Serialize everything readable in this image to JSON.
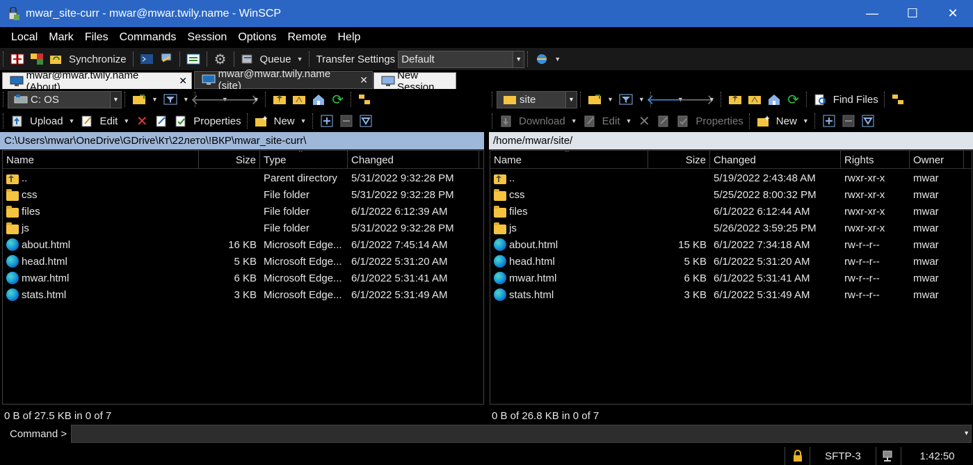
{
  "window": {
    "title": "mwar_site-curr - mwar@mwar.twily.name - WinSCP",
    "minimize": "—",
    "maximize": "☐",
    "close": "✕"
  },
  "menu": [
    "Local",
    "Mark",
    "Files",
    "Commands",
    "Session",
    "Options",
    "Remote",
    "Help"
  ],
  "toolbar": {
    "synchronize": "Synchronize",
    "queue": "Queue",
    "transfer_settings_label": "Transfer Settings",
    "transfer_settings_value": "Default"
  },
  "tabs": [
    {
      "label": "mwar@mwar.twily.name (About)",
      "close": "✕"
    },
    {
      "label": "mwar@mwar.twily.name (site)",
      "close": "✕"
    },
    {
      "label": "New Session"
    }
  ],
  "left": {
    "drive": "C: OS",
    "upload": "Upload",
    "edit": "Edit",
    "properties": "Properties",
    "new": "New",
    "path": "C:\\Users\\mwar\\OneDrive\\GDrive\\Кт\\22лето\\!ВКР\\mwar_site-curr\\",
    "columns": {
      "name": "Name",
      "size": "Size",
      "type": "Type",
      "changed": "Changed"
    },
    "files": [
      {
        "icon": "updir",
        "name": "..",
        "size": "",
        "type": "Parent directory",
        "changed": "5/31/2022  9:32:28 PM"
      },
      {
        "icon": "folder",
        "name": "css",
        "size": "",
        "type": "File folder",
        "changed": "5/31/2022  9:32:28 PM"
      },
      {
        "icon": "folder",
        "name": "files",
        "size": "",
        "type": "File folder",
        "changed": "6/1/2022  6:12:39 AM"
      },
      {
        "icon": "folder",
        "name": "js",
        "size": "",
        "type": "File folder",
        "changed": "5/31/2022  9:32:28 PM"
      },
      {
        "icon": "edge",
        "name": "about.html",
        "size": "16 KB",
        "type": "Microsoft Edge...",
        "changed": "6/1/2022  7:45:14 AM"
      },
      {
        "icon": "edge",
        "name": "head.html",
        "size": "5 KB",
        "type": "Microsoft Edge...",
        "changed": "6/1/2022  5:31:20 AM"
      },
      {
        "icon": "edge",
        "name": "mwar.html",
        "size": "6 KB",
        "type": "Microsoft Edge...",
        "changed": "6/1/2022  5:31:41 AM"
      },
      {
        "icon": "edge",
        "name": "stats.html",
        "size": "3 KB",
        "type": "Microsoft Edge...",
        "changed": "6/1/2022  5:31:49 AM"
      }
    ],
    "status": "0 B of 27.5 KB in 0 of 7"
  },
  "right": {
    "dir": "site",
    "find_files": "Find Files",
    "download": "Download",
    "edit": "Edit",
    "properties": "Properties",
    "new": "New",
    "path": "/home/mwar/site/",
    "columns": {
      "name": "Name",
      "size": "Size",
      "changed": "Changed",
      "rights": "Rights",
      "owner": "Owner"
    },
    "files": [
      {
        "icon": "updir",
        "name": "..",
        "size": "",
        "changed": "5/19/2022 2:43:48 AM",
        "rights": "rwxr-xr-x",
        "owner": "mwar"
      },
      {
        "icon": "folder",
        "name": "css",
        "size": "",
        "changed": "5/25/2022 8:00:32 PM",
        "rights": "rwxr-xr-x",
        "owner": "mwar"
      },
      {
        "icon": "folder",
        "name": "files",
        "size": "",
        "changed": "6/1/2022 6:12:44 AM",
        "rights": "rwxr-xr-x",
        "owner": "mwar"
      },
      {
        "icon": "folder",
        "name": "js",
        "size": "",
        "changed": "5/26/2022 3:59:25 PM",
        "rights": "rwxr-xr-x",
        "owner": "mwar"
      },
      {
        "icon": "edge",
        "name": "about.html",
        "size": "15 KB",
        "changed": "6/1/2022 7:34:18 AM",
        "rights": "rw-r--r--",
        "owner": "mwar"
      },
      {
        "icon": "edge",
        "name": "head.html",
        "size": "5 KB",
        "changed": "6/1/2022 5:31:20 AM",
        "rights": "rw-r--r--",
        "owner": "mwar"
      },
      {
        "icon": "edge",
        "name": "mwar.html",
        "size": "6 KB",
        "changed": "6/1/2022 5:31:41 AM",
        "rights": "rw-r--r--",
        "owner": "mwar"
      },
      {
        "icon": "edge",
        "name": "stats.html",
        "size": "3 KB",
        "changed": "6/1/2022 5:31:49 AM",
        "rights": "rw-r--r--",
        "owner": "mwar"
      }
    ],
    "status": "0 B of 26.8 KB in 0 of 7"
  },
  "command": {
    "label": "Command >"
  },
  "statusbar": {
    "protocol": "SFTP-3",
    "time": "1:42:50"
  },
  "colors": {
    "titlebar": "#2b66c4",
    "left_path_bg": "#9fb8d9",
    "right_path_bg": "#dfe4ea",
    "folder": "#f4c441"
  }
}
